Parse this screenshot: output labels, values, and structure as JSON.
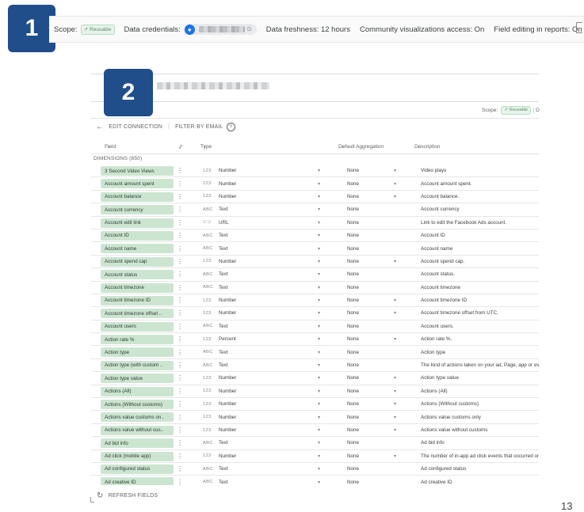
{
  "badges": {
    "one": "1",
    "two": "2"
  },
  "topbar": {
    "scope_label": "Scope:",
    "scope_chip": "Reusable",
    "credentials_label": "Data credentials:",
    "freshness": "Data freshness: 12 hours",
    "community": "Community visualizations access: On",
    "field_editing": "Field editing in reports: On"
  },
  "panel": {
    "scope_label": "Scope:",
    "scope_chip": "Reusable",
    "scope_trailing": "D",
    "edit_connection": "EDIT CONNECTION",
    "filter_by_email": "FILTER BY EMAIL",
    "help_glyph": "?",
    "columns": {
      "field": "Field",
      "type": "Type",
      "aggregation": "Default Aggregation",
      "description": "Description"
    },
    "dimensions_label": "DIMENSIONS (850)",
    "refresh_fields": "REFRESH FIELDS"
  },
  "rows": [
    {
      "field": "3 Second Video Views",
      "icon": "123",
      "type": "Number",
      "agg": "None",
      "agg_caret": true,
      "desc": "Video plays"
    },
    {
      "field": "Account amount spent",
      "icon": "123",
      "type": "Number",
      "agg": "None",
      "agg_caret": true,
      "desc": "Account amount spent."
    },
    {
      "field": "Account balance",
      "icon": "123",
      "type": "Number",
      "agg": "None",
      "agg_caret": true,
      "desc": "Account balance."
    },
    {
      "field": "Account currency",
      "icon": "ABC",
      "type": "Text",
      "agg": "None",
      "agg_caret": false,
      "desc": "Account currency"
    },
    {
      "field": "Account edit link",
      "icon": "⊂⊃",
      "type": "URL",
      "agg": "None",
      "agg_caret": false,
      "desc": "Link to edit the Facebook Ads account."
    },
    {
      "field": "Account ID",
      "icon": "ABC",
      "type": "Text",
      "agg": "None",
      "agg_caret": false,
      "desc": "Account ID"
    },
    {
      "field": "Account name",
      "icon": "ABC",
      "type": "Text",
      "agg": "None",
      "agg_caret": false,
      "desc": "Account name"
    },
    {
      "field": "Account spend cap",
      "icon": "123",
      "type": "Number",
      "agg": "None",
      "agg_caret": true,
      "desc": "Account spend cap."
    },
    {
      "field": "Account status",
      "icon": "ABC",
      "type": "Text",
      "agg": "None",
      "agg_caret": false,
      "desc": "Account status."
    },
    {
      "field": "Account timezone",
      "icon": "ABC",
      "type": "Text",
      "agg": "None",
      "agg_caret": false,
      "desc": "Account timezone"
    },
    {
      "field": "Account timezone ID",
      "icon": "123",
      "type": "Number",
      "agg": "None",
      "agg_caret": true,
      "desc": "Account timezone ID"
    },
    {
      "field": "Account timezone offset ..",
      "icon": "123",
      "type": "Number",
      "agg": "None",
      "agg_caret": true,
      "desc": "Account timezone offset from UTC."
    },
    {
      "field": "Account users",
      "icon": "ABC",
      "type": "Text",
      "agg": "None",
      "agg_caret": false,
      "desc": "Account users."
    },
    {
      "field": "Action rate %",
      "icon": "123",
      "type": "Percent",
      "agg": "None",
      "agg_caret": true,
      "desc": "Action rate %."
    },
    {
      "field": "Action type",
      "icon": "ABC",
      "type": "Text",
      "agg": "None",
      "agg_caret": false,
      "desc": "Action type"
    },
    {
      "field": "Action type (with custom ..",
      "icon": "ABC",
      "type": "Text",
      "agg": "None",
      "agg_caret": false,
      "desc": "The kind of actions taken on your ad, Page, app or eve"
    },
    {
      "field": "Action type value",
      "icon": "123",
      "type": "Number",
      "agg": "None",
      "agg_caret": true,
      "desc": "Action type value"
    },
    {
      "field": "Actions (All)",
      "icon": "123",
      "type": "Number",
      "agg": "None",
      "agg_caret": true,
      "desc": "Actions (All)"
    },
    {
      "field": "Actions (Without customs)",
      "icon": "123",
      "type": "Number",
      "agg": "None",
      "agg_caret": true,
      "desc": "Actions (Without customs)"
    },
    {
      "field": "Actions value customs on..",
      "icon": "123",
      "type": "Number",
      "agg": "None",
      "agg_caret": true,
      "desc": "Actions value customs only"
    },
    {
      "field": "Actions value without cus..",
      "icon": "123",
      "type": "Number",
      "agg": "None",
      "agg_caret": true,
      "desc": "Actions value without customs"
    },
    {
      "field": "Ad bid info",
      "icon": "ABC",
      "type": "Text",
      "agg": "None",
      "agg_caret": false,
      "desc": "Ad bid info"
    },
    {
      "field": "Ad click (mobile app)",
      "icon": "123",
      "type": "Number",
      "agg": "None",
      "agg_caret": true,
      "desc": "The number of in-app ad click events that occurred on"
    },
    {
      "field": "Ad configured status",
      "icon": "ABC",
      "type": "Text",
      "agg": "None",
      "agg_caret": false,
      "desc": "Ad configured status"
    },
    {
      "field": "Ad creative ID",
      "icon": "ABC",
      "type": "Text",
      "agg": "None",
      "agg_caret": false,
      "desc": "Ad creative ID"
    }
  ],
  "page_number": "13"
}
